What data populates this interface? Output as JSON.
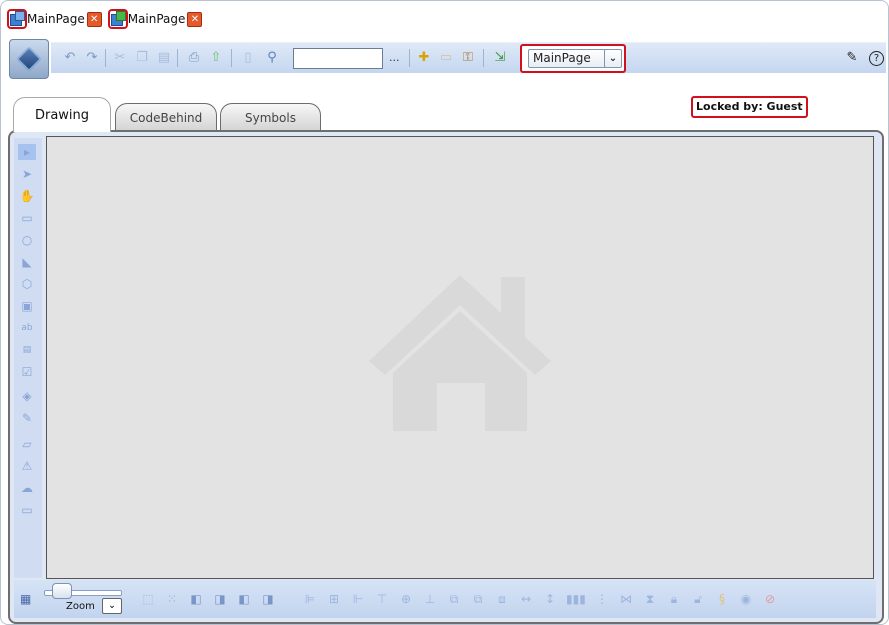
{
  "document_tabs": [
    {
      "label": "MainPage",
      "icon": "page-icon"
    },
    {
      "label": "MainPage",
      "icon": "page-run-icon"
    }
  ],
  "toolbar": {
    "search_value": "",
    "ellipsis": "...",
    "page_select": {
      "selected": "MainPage"
    },
    "icons": [
      "undo-icon",
      "redo-icon",
      "cut-icon",
      "copy-icon",
      "paste-icon",
      "print-icon",
      "upload-icon",
      "page-search-icon",
      "zoom-search-icon",
      "add-icon",
      "note-icon",
      "key-icon",
      "export-icon",
      "edit-note-icon",
      "help-icon"
    ]
  },
  "editor_tabs": [
    {
      "label": "Drawing",
      "active": true
    },
    {
      "label": "CodeBehind",
      "active": false
    },
    {
      "label": "Symbols",
      "active": false
    }
  ],
  "lock_status": "Locked by: Guest",
  "bottom_bar": {
    "zoom_label": "Zoom"
  },
  "colors": {
    "highlight": "#d0101c",
    "toolbar_bg": "#c4d6f0",
    "canvas_bg": "#e3e3e3"
  }
}
